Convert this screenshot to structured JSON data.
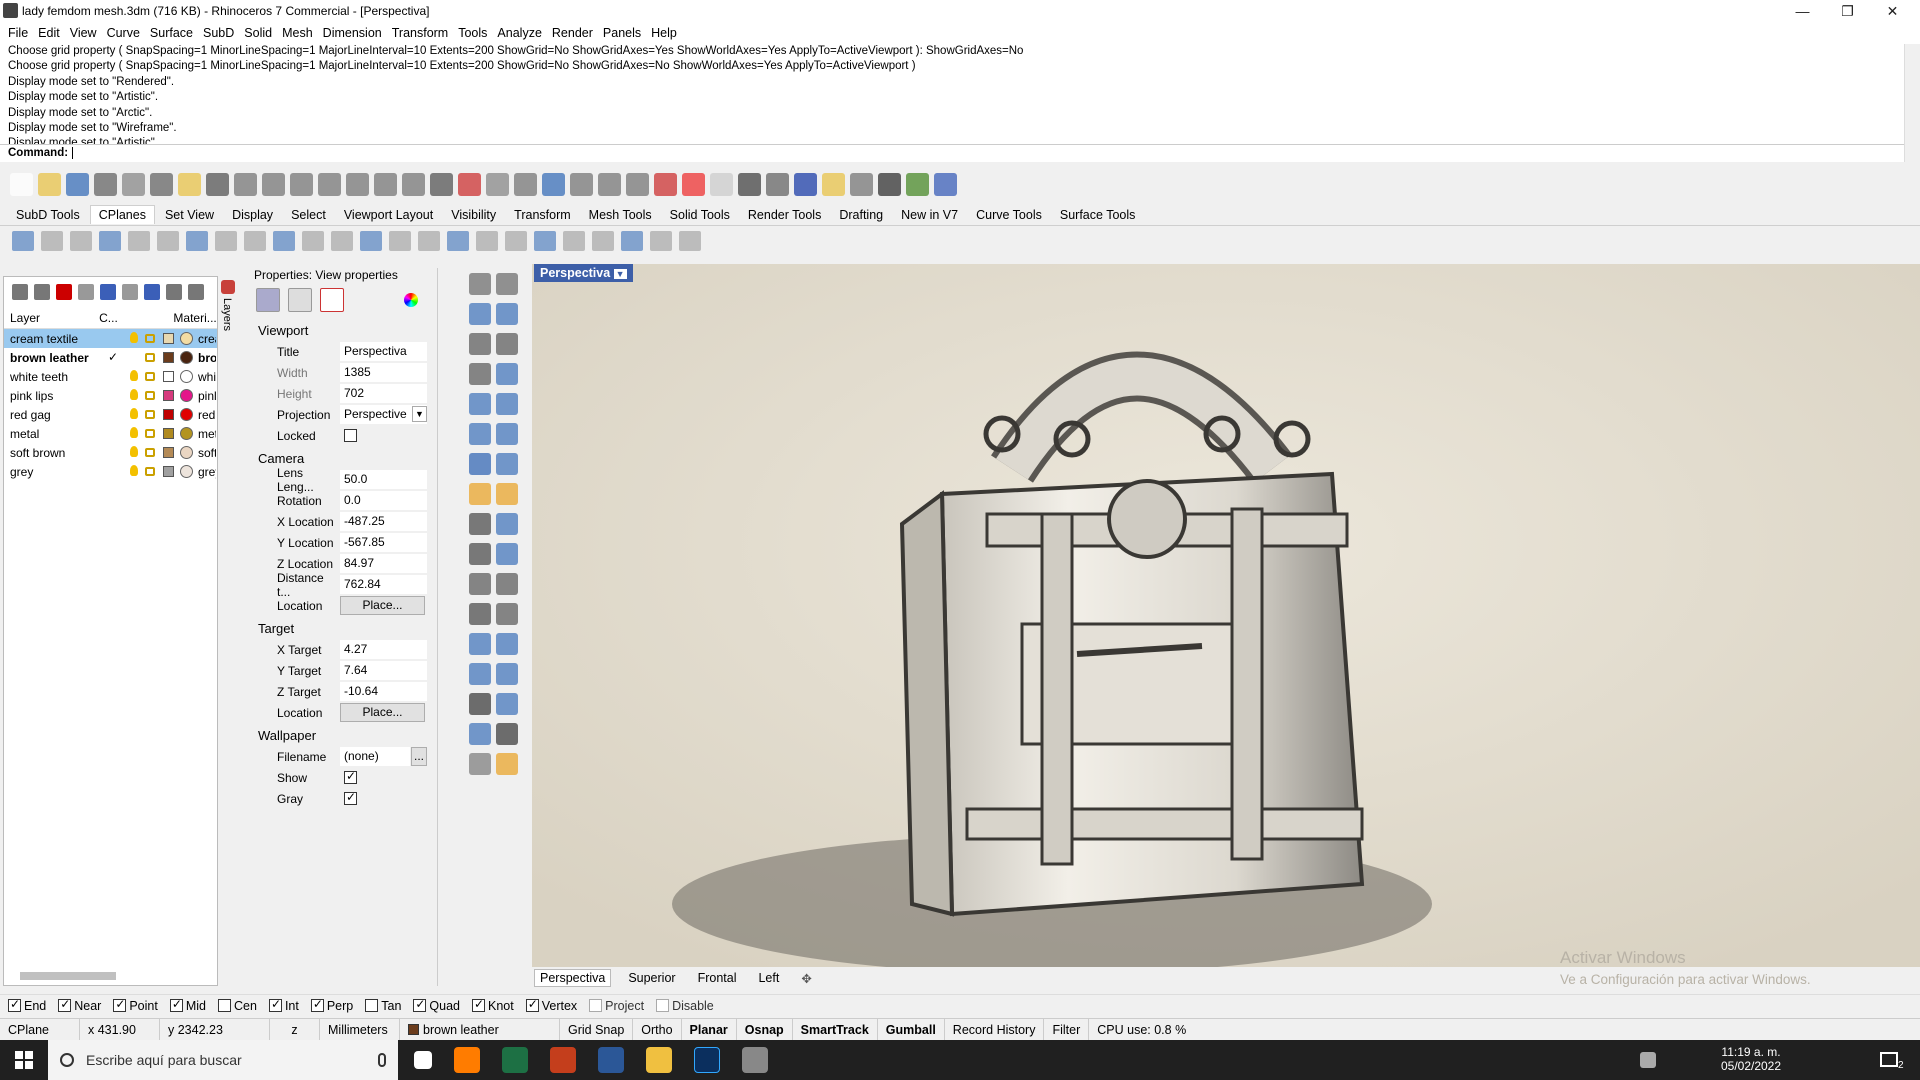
{
  "window": {
    "title": "lady femdom mesh.3dm (716 KB) - Rhinoceros 7 Commercial - [Perspectiva]"
  },
  "menu": [
    "File",
    "Edit",
    "View",
    "Curve",
    "Surface",
    "SubD",
    "Solid",
    "Mesh",
    "Dimension",
    "Transform",
    "Tools",
    "Analyze",
    "Render",
    "Panels",
    "Help"
  ],
  "command": {
    "history": [
      "Choose grid property ( SnapSpacing=1  MinorLineSpacing=1  MajorLineInterval=10  Extents=200  ShowGrid=No  ShowGridAxes=Yes  ShowWorldAxes=Yes  ApplyTo=ActiveViewport ): ShowGridAxes=No",
      "Choose grid property ( SnapSpacing=1  MinorLineSpacing=1  MajorLineInterval=10  Extents=200  ShowGrid=No  ShowGridAxes=No  ShowWorldAxes=Yes  ApplyTo=ActiveViewport )",
      "Display mode set to \"Rendered\".",
      "Display mode set to \"Artistic\".",
      "Display mode set to \"Arctic\".",
      "Display mode set to \"Wireframe\".",
      "Display mode set to \"Artistic\"."
    ],
    "prompt": "Command:"
  },
  "tabs": [
    "SubD Tools",
    "CPlanes",
    "Set View",
    "Display",
    "Select",
    "Viewport Layout",
    "Visibility",
    "Transform",
    "Mesh Tools",
    "Solid Tools",
    "Render Tools",
    "Drafting",
    "New in V7",
    "Curve Tools",
    "Surface Tools"
  ],
  "active_tab": "CPlanes",
  "layers": {
    "panel_tab": "Layers",
    "headers": [
      "Layer",
      "C...",
      "Materi..."
    ],
    "rows": [
      {
        "name": "cream textile",
        "color": "#e8d8b0",
        "mat": "#f3dca3",
        "mat_text": "crea",
        "selected": true
      },
      {
        "name": "brown leather",
        "color": "#6b3c1c",
        "mat": "#4a2410",
        "mat_text": "bro",
        "current": true
      },
      {
        "name": "white teeth",
        "color": "#ffffff",
        "mat": "#ffffff",
        "mat_text": "whi"
      },
      {
        "name": "pink lips",
        "color": "#d63a7d",
        "mat": "#e4168a",
        "mat_text": "pinl"
      },
      {
        "name": "red gag",
        "color": "#c00000",
        "mat": "#e00000",
        "mat_text": "red"
      },
      {
        "name": "metal",
        "color": "#b08a20",
        "mat": "#b39420",
        "mat_text": "met"
      },
      {
        "name": "soft brown",
        "color": "#b48a56",
        "mat": "#ead6c3",
        "mat_text": "soft"
      },
      {
        "name": "grey",
        "color": "#a0a0a0",
        "mat": "#ede4dc",
        "mat_text": "grey"
      }
    ]
  },
  "properties": {
    "title": "Properties: View properties",
    "viewport": {
      "section": "Viewport",
      "title_label": "Title",
      "title": "Perspectiva",
      "width_label": "Width",
      "width": "1385",
      "height_label": "Height",
      "height": "702",
      "projection_label": "Projection",
      "projection": "Perspective",
      "locked_label": "Locked"
    },
    "camera": {
      "section": "Camera",
      "lens_label": "Lens Leng...",
      "lens": "50.0",
      "rotation_label": "Rotation",
      "rotation": "0.0",
      "x_label": "X Location",
      "x": "-487.25",
      "y_label": "Y Location",
      "y": "-567.85",
      "z_label": "Z Location",
      "z": "84.97",
      "dist_label": "Distance t...",
      "dist": "762.84",
      "loc_label": "Location",
      "place": "Place..."
    },
    "target": {
      "section": "Target",
      "x_label": "X Target",
      "x": "4.27",
      "y_label": "Y Target",
      "y": "7.64",
      "z_label": "Z Target",
      "z": "-10.64",
      "loc_label": "Location",
      "place": "Place..."
    },
    "wallpaper": {
      "section": "Wallpaper",
      "file_label": "Filename",
      "file": "(none)",
      "browse": "...",
      "show_label": "Show",
      "gray_label": "Gray"
    }
  },
  "viewport": {
    "active": "Perspectiva",
    "tabs": [
      "Perspectiva",
      "Superior",
      "Frontal",
      "Left"
    ],
    "watermark": "Activar Windows",
    "watermark2": "Ve a Configuración para activar Windows."
  },
  "osnap": [
    "End",
    "Near",
    "Point",
    "Mid",
    "Cen",
    "Int",
    "Perp",
    "Tan",
    "Quad",
    "Knot",
    "Vertex",
    "Project",
    "Disable"
  ],
  "osnap_checked": [
    "End",
    "Near",
    "Point",
    "Mid",
    "Int",
    "Perp",
    "Quad",
    "Knot",
    "Vertex"
  ],
  "status": {
    "cplane": "CPlane",
    "x": "x 431.90",
    "y": "y 2342.23",
    "z": "z",
    "units": "Millimeters",
    "layer": "brown leather",
    "layer_color": "#6b3c1c",
    "grid_snap": "Grid Snap",
    "ortho": "Ortho",
    "planar": "Planar",
    "osnap": "Osnap",
    "smarttrack": "SmartTrack",
    "gumball": "Gumball",
    "record": "Record History",
    "filter": "Filter",
    "cpu": "CPU use: 0.8 %"
  },
  "taskbar": {
    "search": "Escribe aquí para buscar",
    "time": "11:19 a. m.",
    "date": "05/02/2022",
    "notif": "2"
  }
}
